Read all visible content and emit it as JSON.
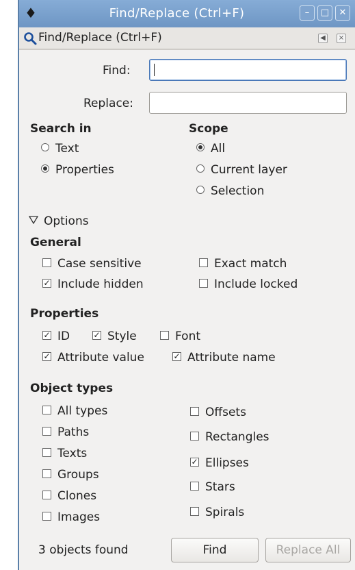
{
  "window": {
    "title": "Find/Replace (Ctrl+F)",
    "app_icon": "inkscape-icon",
    "controls": [
      "minimize-icon",
      "maximize-icon",
      "close-icon"
    ]
  },
  "panel": {
    "title": "Find/Replace (Ctrl+F)",
    "icon": "search-icon"
  },
  "find": {
    "label": "Find:",
    "value": ""
  },
  "replace": {
    "label": "Replace:",
    "value": ""
  },
  "search_in": {
    "heading": "Search in",
    "options": [
      {
        "label": "Text",
        "selected": false
      },
      {
        "label": "Properties",
        "selected": true
      }
    ]
  },
  "scope": {
    "heading": "Scope",
    "options": [
      {
        "label": "All",
        "selected": true
      },
      {
        "label": "Current layer",
        "selected": false
      },
      {
        "label": "Selection",
        "selected": false
      }
    ]
  },
  "options_expander": {
    "label": "Options",
    "expanded": true
  },
  "general": {
    "heading": "General",
    "case_sensitive": {
      "label": "Case sensitive",
      "checked": false
    },
    "exact_match": {
      "label": "Exact match",
      "checked": false
    },
    "include_hidden": {
      "label": "Include hidden",
      "checked": true
    },
    "include_locked": {
      "label": "Include locked",
      "checked": false
    }
  },
  "properties": {
    "heading": "Properties",
    "id": {
      "label": "ID",
      "checked": true
    },
    "style": {
      "label": "Style",
      "checked": true
    },
    "font": {
      "label": "Font",
      "checked": false
    },
    "attribute_value": {
      "label": "Attribute value",
      "checked": true
    },
    "attribute_name": {
      "label": "Attribute name",
      "checked": true
    }
  },
  "object_types": {
    "heading": "Object types",
    "all_types": {
      "label": "All types",
      "checked": false
    },
    "paths": {
      "label": "Paths",
      "checked": false
    },
    "texts": {
      "label": "Texts",
      "checked": false
    },
    "groups": {
      "label": "Groups",
      "checked": false
    },
    "clones": {
      "label": "Clones",
      "checked": false
    },
    "images": {
      "label": "Images",
      "checked": false
    },
    "offsets": {
      "label": "Offsets",
      "checked": false
    },
    "rectangles": {
      "label": "Rectangles",
      "checked": false
    },
    "ellipses": {
      "label": "Ellipses",
      "checked": true
    },
    "stars": {
      "label": "Stars",
      "checked": false
    },
    "spirals": {
      "label": "Spirals",
      "checked": false
    }
  },
  "status": "3 objects found",
  "buttons": {
    "find": "Find",
    "replace_all": "Replace All"
  },
  "colors": {
    "titlebar": "#7aa0cc",
    "window_bg": "#f2f1f0",
    "focus_border": "#4a78b8"
  }
}
